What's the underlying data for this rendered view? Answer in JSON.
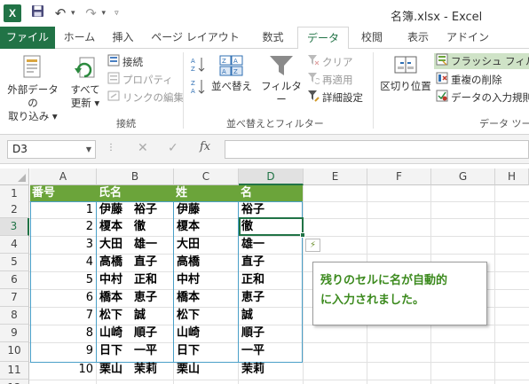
{
  "window": {
    "title": "名簿.xlsx - Excel",
    "logo_text": "X"
  },
  "tabs": [
    {
      "label": "ファイル",
      "active": false
    },
    {
      "label": "ホーム",
      "active": false
    },
    {
      "label": "挿入",
      "active": false
    },
    {
      "label": "ページ レイアウト",
      "active": false
    },
    {
      "label": "数式",
      "active": false
    },
    {
      "label": "データ",
      "active": true
    },
    {
      "label": "校閲",
      "active": false
    },
    {
      "label": "表示",
      "active": false
    },
    {
      "label": "アドイン",
      "active": false
    }
  ],
  "ribbon": {
    "external_data": {
      "line1": "外部データの",
      "line2": "取り込み ▾"
    },
    "refresh_all": {
      "line1": "すべて",
      "line2": "更新 ▾"
    },
    "connections": "接続",
    "properties": "プロパティ",
    "edit_links": "リンクの編集",
    "group_connections": "接続",
    "sort_label": "並べ替え",
    "filter_label": "フィルター",
    "clear": "クリア",
    "reapply": "再適用",
    "advanced": "詳細設定",
    "group_sort_filter": "並べ替えとフィルター",
    "text_to_columns": "区切り位置",
    "flash_fill": "フラッシュ フィル",
    "remove_duplicates": "重複の削除",
    "data_validation": "データの入力規則",
    "group_data_tools": "データ ツー"
  },
  "formula_bar": {
    "name_box": "D3",
    "fx": "fx",
    "cancel": "✕",
    "enter": "✓",
    "formula": ""
  },
  "columns": [
    "A",
    "B",
    "C",
    "D",
    "E",
    "F",
    "G",
    "H"
  ],
  "rows": [
    "1",
    "2",
    "3",
    "4",
    "5",
    "6",
    "7",
    "8",
    "9",
    "10",
    "11",
    "12"
  ],
  "table": {
    "headers": [
      "番号",
      "氏名",
      "姓",
      "名"
    ],
    "data": [
      [
        "1",
        "伊藤　裕子",
        "伊藤",
        "裕子"
      ],
      [
        "2",
        "榎本　徹",
        "榎本",
        "徹"
      ],
      [
        "3",
        "大田　雄一",
        "大田",
        "雄一"
      ],
      [
        "4",
        "高橋　直子",
        "高橋",
        "直子"
      ],
      [
        "5",
        "中村　正和",
        "中村",
        "正和"
      ],
      [
        "6",
        "橋本　恵子",
        "橋本",
        "恵子"
      ],
      [
        "7",
        "松下　誠",
        "松下",
        "誠"
      ],
      [
        "8",
        "山崎　順子",
        "山崎",
        "順子"
      ],
      [
        "9",
        "日下　一平",
        "日下",
        "一平"
      ],
      [
        "10",
        "栗山　茉莉",
        "栗山",
        "茉莉"
      ]
    ]
  },
  "callout": {
    "line1": "残りのセルに名が自動的",
    "line2": "に入力されました。"
  },
  "colors": {
    "excel_green": "#217346",
    "table_header": "#6ba43a",
    "table_border": "#4aa0c8",
    "callout_text": "#3c8a1e"
  }
}
